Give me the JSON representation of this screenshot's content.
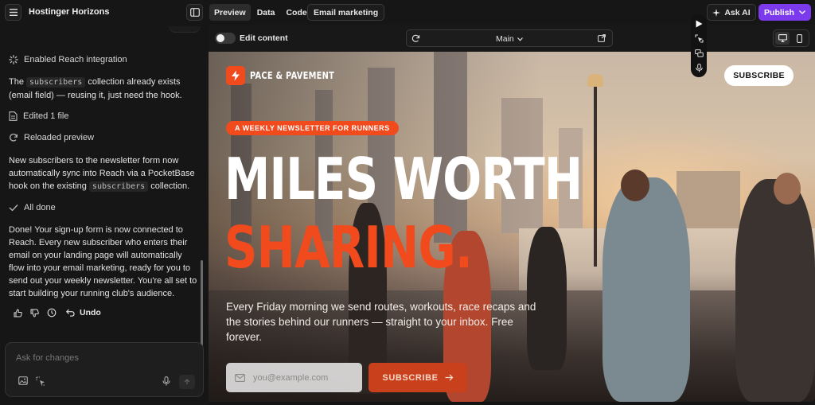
{
  "app": {
    "title": "Hostinger Horizons"
  },
  "tabs": [
    {
      "label": "Preview"
    },
    {
      "label": "Data"
    },
    {
      "label": "Code"
    }
  ],
  "email_tab": "Email marketing",
  "ask_ai": "Ask AI",
  "publish": "Publish",
  "chat": {
    "step_reach": "Enabled Reach integration",
    "msg1_a": "The",
    "msg1_code": "subscribers",
    "msg1_b": "collection already exists (email field) — reusing it, just need the hook.",
    "step_edit": "Edited 1 file",
    "step_reload": "Reloaded preview",
    "msg2_a": "New subscribers to the newsletter form now automatically sync into Reach via a PocketBase hook on the existing",
    "msg2_code": "subscribers",
    "msg2_b": "collection.",
    "step_done": "All done",
    "msg3": "Done! Your sign-up form is now connected to Reach. Every new subscriber who enters their email on your landing page will automatically flow into your email marketing, ready for you to send out your weekly newsletter. You're all set to start building your running club's audience.",
    "undo": "Undo",
    "composer_placeholder": "Ask for changes"
  },
  "preview_toolbar": {
    "edit_content": "Edit content",
    "page": "Main"
  },
  "site": {
    "brand": "PACE & PAVEMENT",
    "subscribe_top": "SUBSCRIBE",
    "pill": "A WEEKLY NEWSLETTER FOR RUNNERS",
    "headline1": "MILES WORTH",
    "headline2": "SHARING.",
    "lede": "Every Friday morning we send routes, workouts, race recaps and the stories behind our runners — straight to your inbox. Free forever.",
    "email_placeholder": "you@example.com",
    "subscribe_btn": "SUBSCRIBE"
  },
  "colors": {
    "accent": "#f04a1d",
    "publish": "#7c3aed",
    "panel": "#161616"
  }
}
